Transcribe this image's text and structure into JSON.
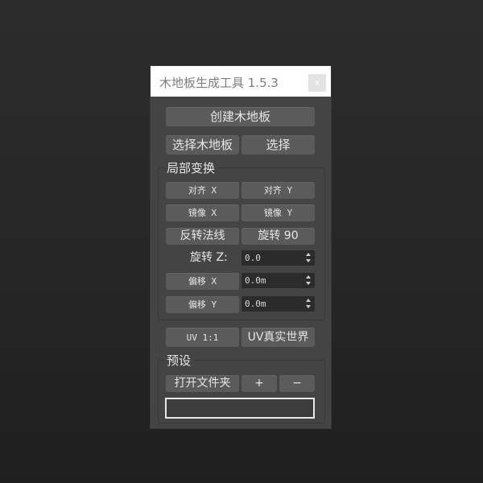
{
  "window": {
    "title": "木地板生成工具 1.5.3",
    "close_label": "x"
  },
  "buttons": {
    "create_floor": "创建木地板",
    "select_floor": "选择木地板",
    "select": "选择"
  },
  "local_transform": {
    "label": "局部变换",
    "align_x": "对齐 X",
    "align_y": "对齐 Y",
    "mirror_x": "镜像 X",
    "mirror_y": "镜像 Y",
    "flip_normals": "反转法线",
    "rotate_90": "旋转 90",
    "rotate_z_label": "旋转 Z:",
    "rotate_z_value": "0.0",
    "offset_x_button": "偏移 X",
    "offset_x_value": "0.0m",
    "offset_y_button": "偏移 Y",
    "offset_y_value": "0.0m"
  },
  "uv": {
    "uv_1to1": "UV 1:1",
    "uv_real_world": "UV真实世界"
  },
  "presets": {
    "label": "预设",
    "open_folder": "打开文件夹",
    "add": "+",
    "remove": "−"
  },
  "colors": {
    "panel_bg": "#444444",
    "button_bg": "#5b5b5b",
    "field_bg": "#2b2b2b",
    "text": "#e6e6e6"
  }
}
